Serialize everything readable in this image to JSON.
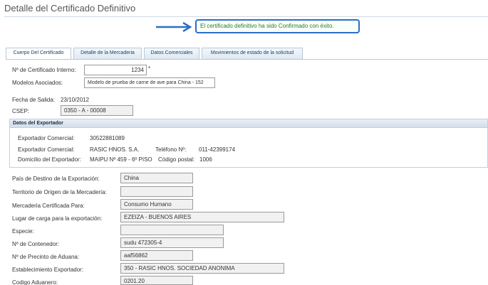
{
  "page": {
    "title": "Detalle del Certificado Definitivo",
    "success_message": "El certificado definitivo ha sido Confirmado con éxito."
  },
  "tabs": [
    {
      "label": "Cuerpo Del Certificado",
      "active": true
    },
    {
      "label": "Detalle de la Mercaderia",
      "active": false
    },
    {
      "label": "Datos Comerciales",
      "active": false
    },
    {
      "label": "Movimientos de estado de la solicitud",
      "active": false
    }
  ],
  "header_fields": {
    "cert_interno_label": "Nº de Certificado Interno:",
    "cert_interno_value": "1234",
    "required_mark": "*",
    "modelos_label": "Modelos Asociados:",
    "modelos_value": "Modelo de prueba de carne de ave para China - 152",
    "fecha_salida_label": "Fecha de Salida:",
    "fecha_salida_value": "23/10/2012",
    "csep_label": "CSEP:",
    "csep_value": "0350 - A - 00008"
  },
  "exportador": {
    "section_title": "Datos del Exportador",
    "comercial_label_1": "Exportador Comercial:",
    "comercial_value_1": "30522881089",
    "comercial_label_2": "Exportador Comercial:",
    "comercial_value_2": "RASIC HNOS. S.A.",
    "telefono_label": "Teléfono Nº:",
    "telefono_value": "011-42399174",
    "domicilio_label": "Domicilio del Exportador:",
    "domicilio_value": "MAIPU Nº 459 - 6º PISO",
    "codigo_postal_label": "Código postal:",
    "codigo_postal_value": "1006"
  },
  "form_rows": [
    {
      "label": "País de Destino de la Exportación:",
      "value": "China"
    },
    {
      "label": "Territorio de Origen de la Mercadería:",
      "value": ""
    },
    {
      "label": "Mercaderia Certificada Para:",
      "value": "Consumo Humano"
    },
    {
      "label": "Lugar de carga para la exportación:",
      "value": "EZEIZA - BUENOS AIRES"
    },
    {
      "label": "Especie:",
      "value": ""
    },
    {
      "label": "Nº de Contenedor:",
      "value": "sudu 472305-4"
    },
    {
      "label": "Nº de Precinto de Aduana:",
      "value": "aaf56862"
    },
    {
      "label": "Establecimiento Exportador:",
      "value": "350 - RASIC HNOS. SOCIEDAD ANONIMA"
    },
    {
      "label": "Codigo Aduanero:",
      "value": "0201.20"
    }
  ],
  "colors": {
    "accent": "#2a6ec9",
    "success_text": "#2a7a2a",
    "field_bg": "#f1f1f1"
  }
}
